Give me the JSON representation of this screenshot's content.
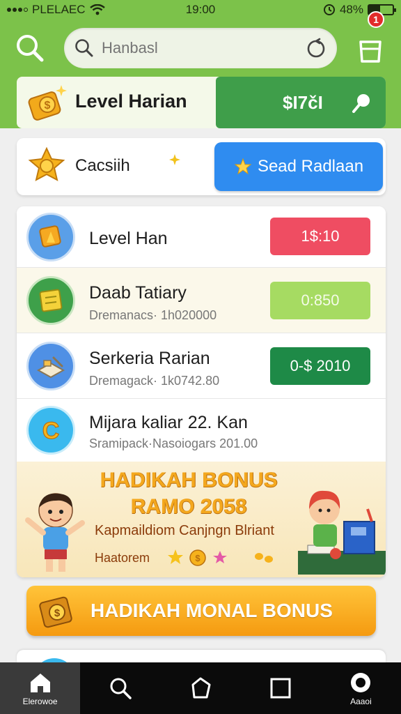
{
  "status_bar": {
    "carrier": "PLELAEC",
    "time": "19:00",
    "battery_text": "48%",
    "battery_level": 0.48
  },
  "header": {
    "search_placeholder": "Hanbasl",
    "cart_badge": "1"
  },
  "level_card": {
    "title": "Level Harian",
    "button_label": "$I7čI"
  },
  "cash_card": {
    "title": "Cacsiih",
    "button_label": "Sead Radlaan"
  },
  "list": {
    "rows": [
      {
        "name": "Level Han",
        "sub": "",
        "pill": "1$:10"
      },
      {
        "name": "Daab Tatiary",
        "sub": "Dremanacs· 1h020000",
        "pill": "0:850"
      },
      {
        "name": "Serkeria Rarian",
        "sub": "Dremagack· 1k0742.80",
        "pill": "0-$ 2010"
      },
      {
        "name": "Mijara kaliar 22. Kan",
        "sub": "Sramipack·Nasoiogars 201.00",
        "pill": ""
      }
    ]
  },
  "banner": {
    "headline_1": "HADIKAH BONUS",
    "headline_2": "RAMO 2058",
    "subtitle": "Kapmaildiom Canjngn Blriant",
    "small_label": "Haatorem"
  },
  "bonus_button": {
    "label": "HADIKAH MONAL BONUS"
  },
  "bottom_nav": {
    "items": [
      {
        "label": "Elerowoe",
        "icon": "home-icon"
      },
      {
        "label": "",
        "icon": "search-icon"
      },
      {
        "label": "",
        "icon": "tag-icon"
      },
      {
        "label": "",
        "icon": "square-icon"
      },
      {
        "label": "Aaaoi",
        "icon": "profile-icon"
      }
    ]
  },
  "colors": {
    "header_green": "#7cc24a",
    "level_button_green": "#3f9e4a",
    "cash_button_blue": "#2f8cf0",
    "pill_red": "#ef4d62",
    "pill_light_green": "#a6db62",
    "pill_dark_green": "#1e8a47",
    "bonus_orange": "#f59a10",
    "nav_black": "#0b0b0b"
  }
}
